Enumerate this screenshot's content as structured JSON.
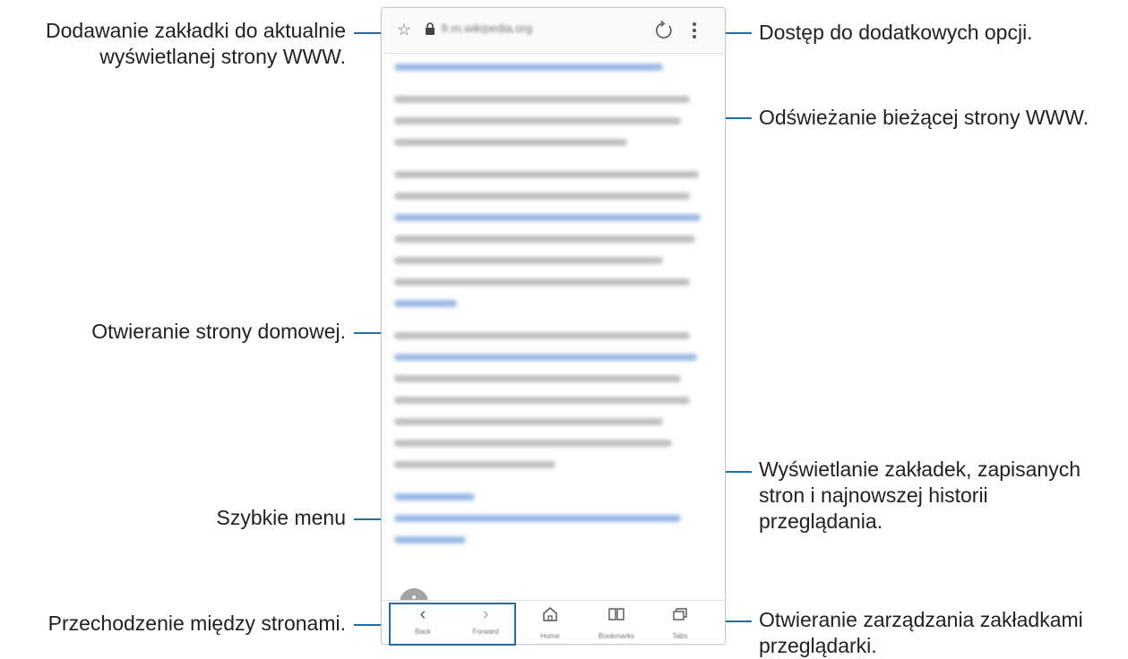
{
  "callouts": {
    "bookmark_add": "Dodawanie zakładki do aktualnie\nwyświetlanej strony WWW.",
    "more_options": "Dostęp do dodatkowych opcji.",
    "refresh": "Odświeżanie bieżącej strony WWW.",
    "home": "Otwieranie strony domowej.",
    "bookmarks": "Wyświetlanie zakładek, zapisanych\nstron i najnowszej historii\nprzeglądania.",
    "quick_menu": "Szybkie menu",
    "navigate": "Przechodzenie między stronami.",
    "tabs": "Otwieranie zarządzania zakładkami\nprzeglądarki."
  },
  "browser": {
    "url": "fr.m.wikipedia.org",
    "nav": {
      "back": "Back",
      "forward": "Forward",
      "home": "Home",
      "bookmarks": "Bookmarks",
      "tabs": "Tabs"
    }
  },
  "colors": {
    "accent": "#1f6fa8",
    "link": "#4b7fd1"
  },
  "icons": [
    "star-icon",
    "lock-icon",
    "refresh-icon",
    "more-options-icon",
    "back-icon",
    "forward-icon",
    "home-icon",
    "bookmarks-icon",
    "tabs-icon",
    "quick-menu-icon"
  ]
}
